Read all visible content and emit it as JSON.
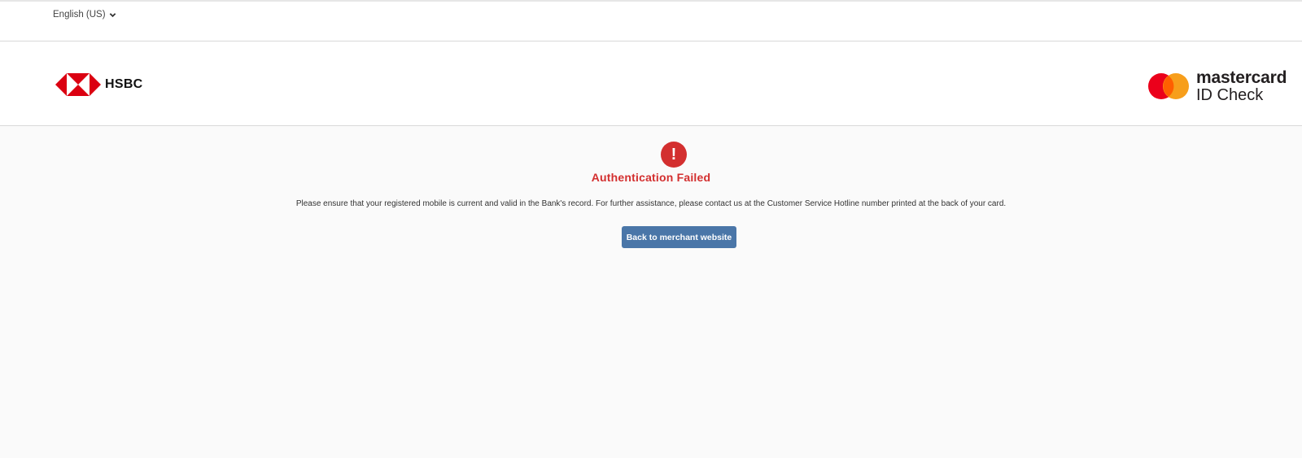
{
  "language_selector": {
    "label": "English (US)",
    "icon": "chevron-down-icon"
  },
  "header": {
    "bank_logo_text": "HSBC",
    "network_logo": {
      "brand": "mastercard",
      "product": "ID Check"
    }
  },
  "result": {
    "icon": "exclamation-icon",
    "title": "Authentication Failed",
    "message": "Please ensure that your registered mobile is current and valid in the Bank's record. For further assistance, please contact us at the Customer Service Hotline number printed at the back of your card.",
    "button_label": "Back to merchant website"
  },
  "colors": {
    "error": "#d32f2f",
    "button": "#4a76a8",
    "hsbc_red": "#db0011",
    "mc_red": "#eb001b",
    "mc_orange": "#f79e1b"
  }
}
